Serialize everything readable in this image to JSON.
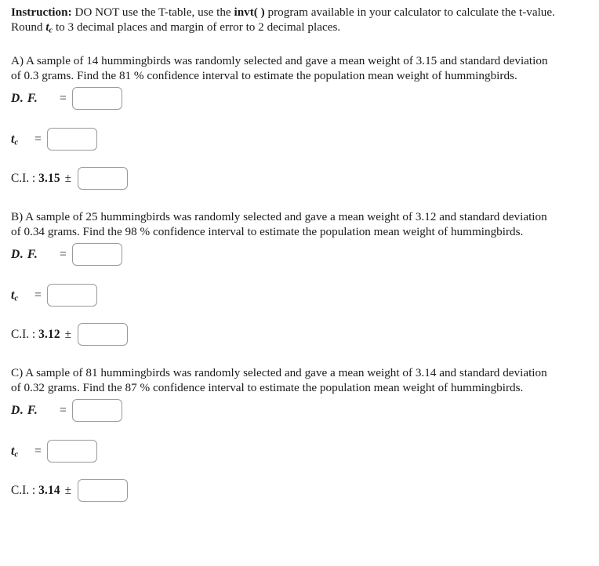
{
  "instruction": {
    "label": "Instruction:",
    "part1": " DO NOT use the T-table, use the ",
    "bold_term": "invt( )",
    "part2": " program available in your calculator to calculate the t-value. Round ",
    "math_t": "t",
    "math_sub": "c",
    "part3": " to 3 decimal places and margin of error to 2 decimal places."
  },
  "fields": {
    "df_label": "D. F.",
    "tc_label": "t",
    "tc_sub": "c",
    "equals": "=",
    "ci_label": "C.I. :",
    "plus_minus": "±",
    "placeholder": ""
  },
  "problems": [
    {
      "letter": "A)",
      "text": "A sample of 14 hummingbirds was randomly selected and gave a mean weight of 3.15 and standard deviation of 0.3 grams. Find the 81 % confidence interval to estimate the population mean weight of hummingbirds.",
      "sample_size": "14",
      "mean": "3.15",
      "std_dev": "0.3",
      "confidence": "81 %",
      "df_value": "",
      "tc_value": "",
      "ci_value": ""
    },
    {
      "letter": "B)",
      "text": "A sample of 25 hummingbirds was randomly selected and gave a mean weight of 3.12 and standard deviation of 0.34 grams. Find the 98 % confidence interval to estimate the population mean weight of hummingbirds.",
      "sample_size": "25",
      "mean": "3.12",
      "std_dev": "0.34",
      "confidence": "98 %",
      "df_value": "",
      "tc_value": "",
      "ci_value": ""
    },
    {
      "letter": "C)",
      "text": "A sample of 81 hummingbirds was randomly selected and gave a mean weight of 3.14 and standard deviation of 0.32 grams. Find the 87 % confidence interval to estimate the population mean weight of hummingbirds.",
      "sample_size": "81",
      "mean": "3.14",
      "std_dev": "0.32",
      "confidence": "87 %",
      "df_value": "",
      "tc_value": "",
      "ci_value": ""
    }
  ],
  "colors": {
    "text": "#1a1a1a",
    "field_border": "#9a9a9a",
    "background": "#ffffff"
  }
}
